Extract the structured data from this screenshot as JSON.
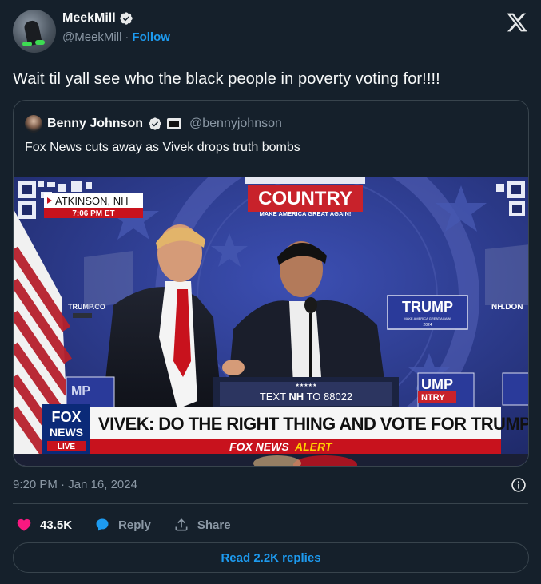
{
  "author": {
    "display_name": "MeekMill",
    "handle": "@MeekMill",
    "separator": "·",
    "follow_label": "Follow"
  },
  "tweet": {
    "text": "Wait til yall see who the black people in poverty voting for!!!!",
    "timestamp": "9:20 PM · Jan 16, 2024"
  },
  "quoted": {
    "display_name": "Benny Johnson",
    "handle": "@bennyjohnson",
    "text": "Fox News cuts away as Vivek drops truth bombs",
    "video": {
      "location": "ATKINSON, NH",
      "time": "7:06 PM ET",
      "banner_top": "COUNTRY",
      "banner_sub": "MAKE AMERICA GREAT AGAIN!",
      "sign_right": "TRUMP",
      "sign_right_sub": "MAKE AMERICA GREAT AGAIN!",
      "sign_right_year": "2024",
      "url_left": "TRUMP.CO",
      "url_right": "NH.DON",
      "podium_stars": "★★★★★",
      "podium_text_prefix": "TEXT ",
      "podium_text_bold": "NH",
      "podium_text_suffix": " TO 88022",
      "side_sign_left": "MP",
      "side_sign_right_1": "UMP",
      "side_sign_right_2": "NTRY",
      "fox_logo_1": "FOX",
      "fox_logo_2": "NEWS",
      "fox_live": "LIVE",
      "chyron": "VIVEK: DO THE RIGHT THING AND VOTE FOR TRUMP",
      "alert_brand": "FOX NEWS",
      "alert_word": "ALERT"
    }
  },
  "engagement": {
    "likes": "43.5K",
    "reply_label": "Reply",
    "share_label": "Share",
    "read_replies_label": "Read 2.2K replies"
  },
  "colors": {
    "background": "#15202b",
    "accent": "#1d9bf0",
    "like": "#f91880",
    "border": "#38444d"
  }
}
